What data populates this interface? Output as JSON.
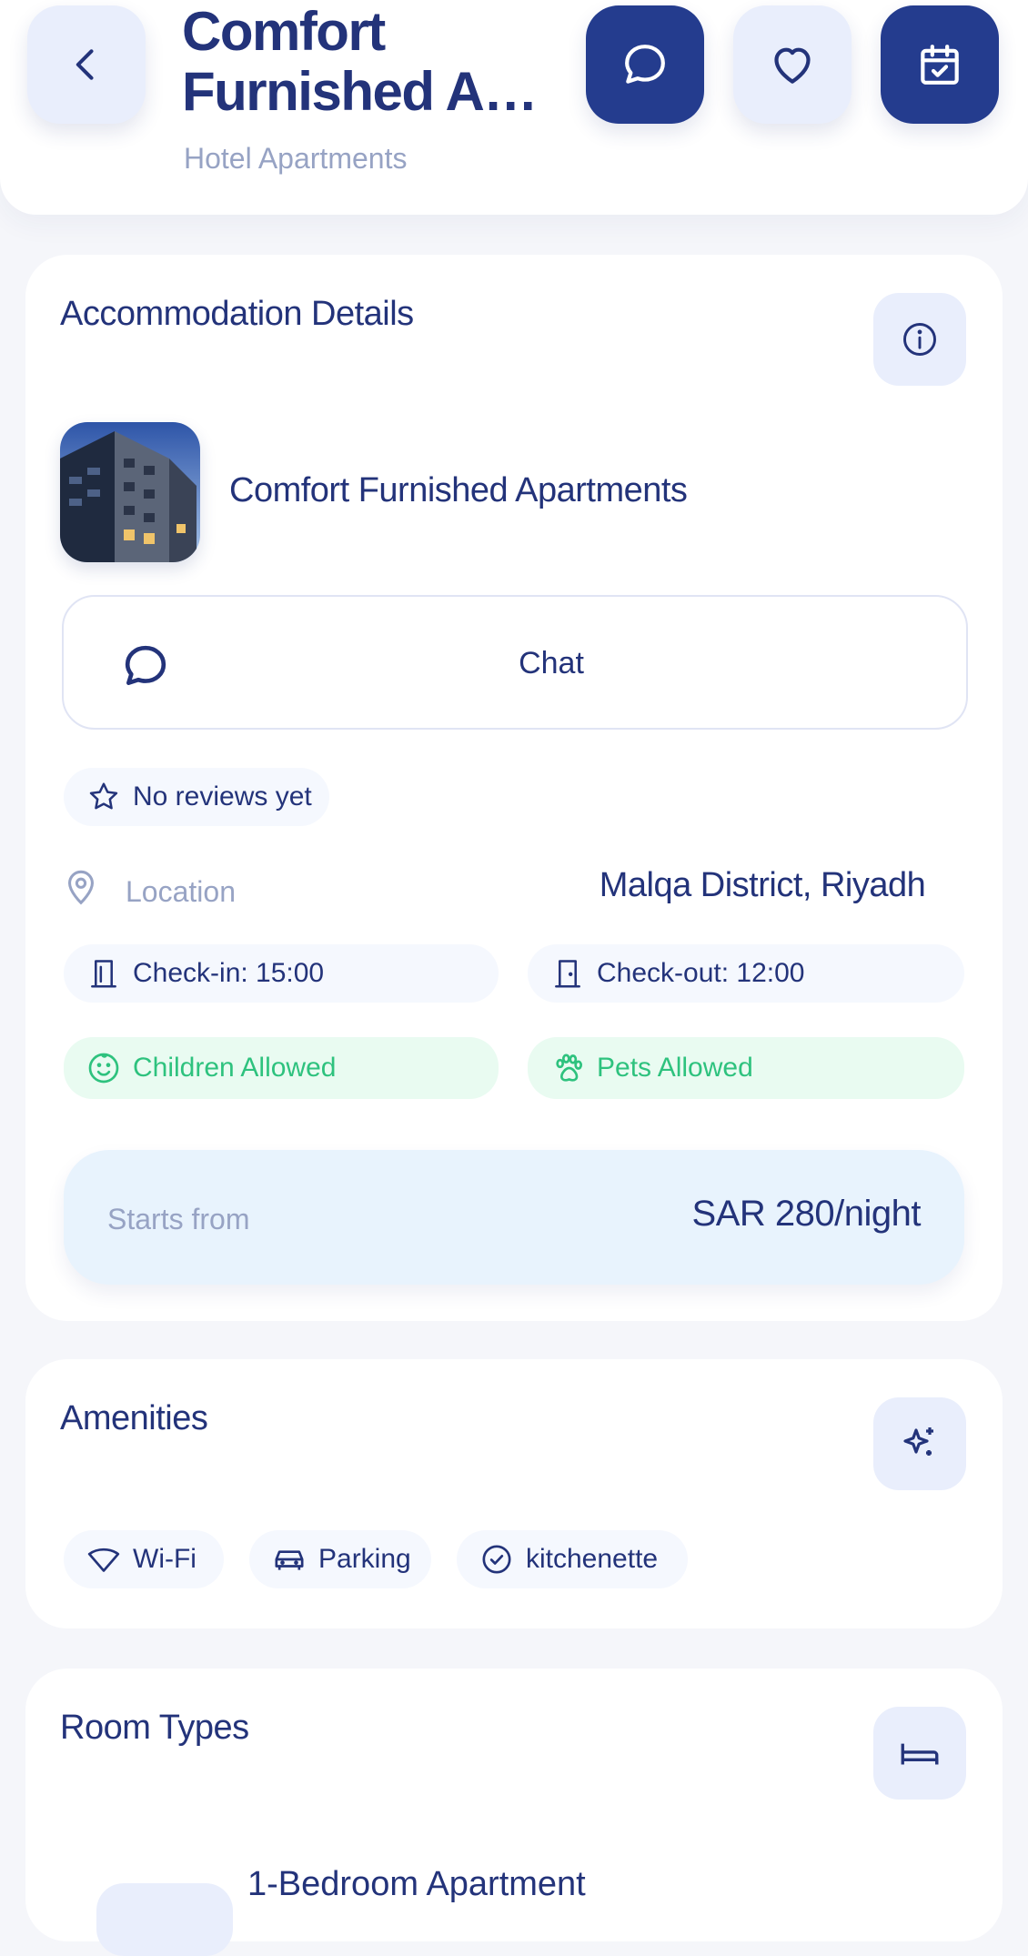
{
  "header": {
    "title_line1": "Comfort",
    "title_line2": "Furnished Apa...",
    "subtitle": "Hotel Apartments"
  },
  "accommodation": {
    "section_title": "Accommodation Details",
    "name": "Comfort Furnished Apartments",
    "chat_label": "Chat",
    "reviews": "No reviews yet",
    "location_label": "Location",
    "location_value": "Malqa District, Riyadh",
    "check_in": "Check-in: 15:00",
    "check_out": "Check-out: 12:00",
    "children": "Children Allowed",
    "pets": "Pets Allowed",
    "price_label": "Starts from",
    "price_value": "SAR 280/night"
  },
  "amenities": {
    "section_title": "Amenities",
    "items": [
      "Wi-Fi",
      "Parking",
      "kitchenette"
    ]
  },
  "room_types": {
    "section_title": "Room Types",
    "first_item": "1-Bedroom Apartment"
  },
  "colors": {
    "primary": "#23337a",
    "primary_button": "#243c8e",
    "light_button": "#e9eefc",
    "muted_text": "#97a3c4",
    "green": "#2ec27e",
    "price_bg": "#e8f3fd"
  }
}
